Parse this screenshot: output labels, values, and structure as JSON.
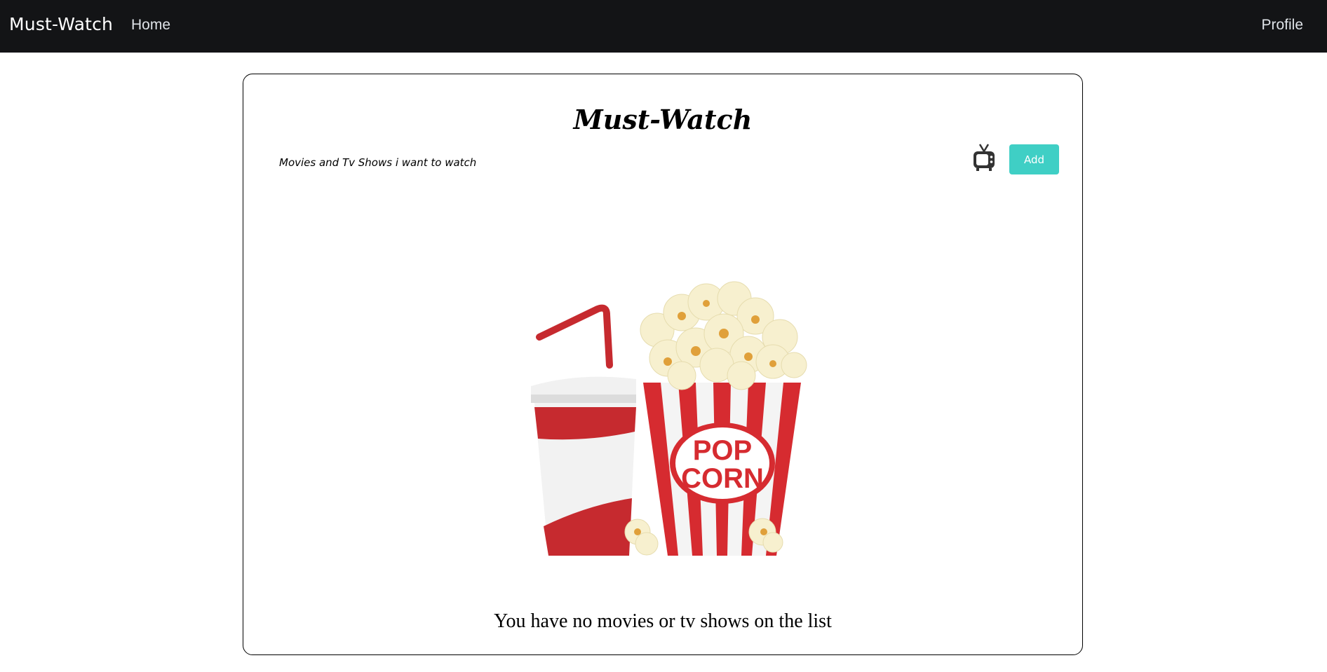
{
  "navbar": {
    "brand": "Must-Watch",
    "home_label": "Home",
    "profile_label": "Profile"
  },
  "card": {
    "title": "Must-Watch",
    "subtitle": "Movies and Tv Shows i want to watch",
    "tv_icon": "tv-icon",
    "add_label": "Add",
    "accent_color": "#3fcfc5",
    "illustration": {
      "label_top": "POP",
      "label_bottom": "CORN"
    },
    "empty_message": "You have no movies or tv shows on the list"
  }
}
